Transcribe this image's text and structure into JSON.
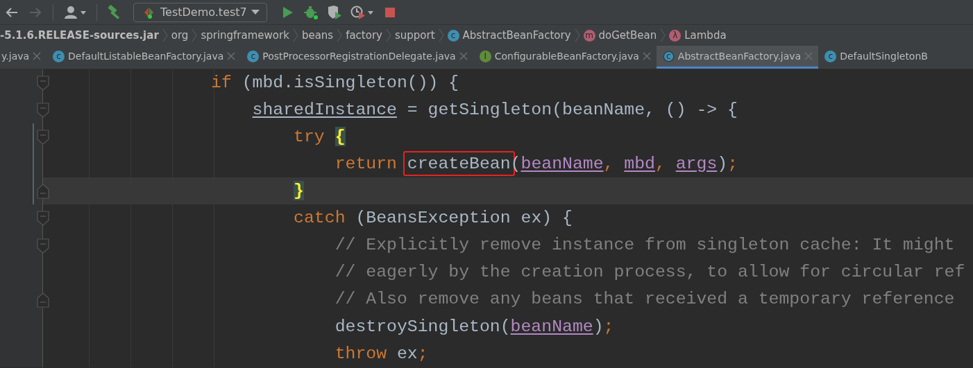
{
  "toolbar": {
    "buttons": [
      {
        "kind": "back",
        "disabled": false
      },
      {
        "kind": "forward",
        "disabled": true
      },
      {
        "kind": "separator"
      },
      {
        "kind": "user"
      },
      {
        "kind": "separator"
      },
      {
        "kind": "build"
      },
      {
        "kind": "run-config",
        "label": "TestDemo.test7"
      },
      {
        "kind": "run"
      },
      {
        "kind": "debug"
      },
      {
        "kind": "coverage"
      },
      {
        "kind": "profile"
      },
      {
        "kind": "stop"
      }
    ]
  },
  "breadcrumbs": [
    {
      "label": "-5.1.6.RELEASE-sources.jar",
      "bold": true
    },
    {
      "label": "org",
      "bold": false
    },
    {
      "label": "springframework",
      "bold": false
    },
    {
      "label": "beans",
      "bold": false
    },
    {
      "label": "factory",
      "bold": false
    },
    {
      "label": "support",
      "bold": false
    },
    {
      "label": "AbstractBeanFactory",
      "bold": false,
      "icon": {
        "kind": "class",
        "glyph": "c"
      }
    },
    {
      "label": "doGetBean",
      "bold": false,
      "icon": {
        "kind": "method",
        "glyph": "m"
      }
    },
    {
      "label": "Lambda",
      "bold": false,
      "icon": {
        "kind": "lambda",
        "glyph": "λ"
      }
    }
  ],
  "tabs": [
    {
      "label": "y.java",
      "selected": false,
      "closable": true
    },
    {
      "label": "DefaultListableBeanFactory.java",
      "selected": false,
      "closable": true,
      "icon": {
        "kind": "class",
        "glyph": "c"
      }
    },
    {
      "label": "PostProcessorRegistrationDelegate.java",
      "selected": false,
      "closable": true,
      "icon": {
        "kind": "class",
        "glyph": "c"
      }
    },
    {
      "label": "ConfigurableBeanFactory.java",
      "selected": false,
      "closable": true,
      "icon": {
        "kind": "interface",
        "glyph": "I"
      }
    },
    {
      "label": "AbstractBeanFactory.java",
      "selected": true,
      "closable": true,
      "icon": {
        "kind": "abstract",
        "glyph": "c"
      }
    },
    {
      "label": "DefaultSingletonB",
      "selected": false,
      "closable": false,
      "icon": {
        "kind": "class",
        "glyph": "c"
      }
    }
  ],
  "editor": {
    "lines": [
      {
        "fold": {
          "kind": "open"
        },
        "changed": false,
        "tokens": [
          {
            "kind": "kw",
            "text": "if"
          },
          {
            "kind": "plain",
            "text": " (mbd.isSingleton()) {"
          }
        ],
        "children": [
          {
            "fold": {
              "kind": "open"
            },
            "changed": false,
            "tokens": [
              {
                "kind": "underlined",
                "text": "sharedInstance"
              },
              {
                "kind": "plain",
                "text": " = getSingleton(beanName, () -> {"
              }
            ],
            "children": [
              {
                "fold": {
                  "kind": "open"
                },
                "changed": true,
                "tokens": [
                  {
                    "kind": "kw",
                    "text": "try "
                  },
                  {
                    "kind": "match",
                    "text": "{"
                  }
                ],
                "children": [
                  {
                    "changed": true,
                    "tokens": [
                      {
                        "kind": "kw",
                        "text": "return "
                      },
                      {
                        "kind": "plain",
                        "text": "createBean",
                        "boxed": true
                      },
                      {
                        "kind": "plain",
                        "text": "("
                      },
                      {
                        "kind": "captured",
                        "text": "beanName"
                      },
                      {
                        "kind": "kw",
                        "text": ", "
                      },
                      {
                        "kind": "captured",
                        "text": "mbd"
                      },
                      {
                        "kind": "kw",
                        "text": ", "
                      },
                      {
                        "kind": "captured",
                        "text": "args"
                      },
                      {
                        "kind": "plain",
                        "text": ")"
                      },
                      {
                        "kind": "kw",
                        "text": ";"
                      }
                    ]
                  }
                ]
              },
              {
                "fold": {
                  "kind": "close"
                },
                "changed": true,
                "current": true,
                "tokens": [
                  {
                    "kind": "match",
                    "text": "}"
                  }
                ]
              },
              {
                "fold": {
                  "kind": "open"
                },
                "changed": false,
                "tokens": [
                  {
                    "kind": "kw",
                    "text": "catch "
                  },
                  {
                    "kind": "plain",
                    "text": "(BeansException ex) {"
                  }
                ],
                "children": [
                  {
                    "fold": {
                      "kind": "open"
                    },
                    "changed": false,
                    "tokens": [
                      {
                        "kind": "comment",
                        "text": "// Explicitly remove instance from singleton cache: It might"
                      }
                    ]
                  },
                  {
                    "changed": false,
                    "tokens": [
                      {
                        "kind": "comment",
                        "text": "// eagerly by the creation process, to allow for circular ref"
                      }
                    ]
                  },
                  {
                    "fold": {
                      "kind": "close"
                    },
                    "changed": false,
                    "tokens": [
                      {
                        "kind": "comment",
                        "text": "// Also remove any beans that received a temporary reference"
                      }
                    ]
                  },
                  {
                    "changed": false,
                    "tokens": [
                      {
                        "kind": "plain",
                        "text": "destroySingleton("
                      },
                      {
                        "kind": "captured",
                        "text": "beanName"
                      },
                      {
                        "kind": "plain",
                        "text": ")"
                      },
                      {
                        "kind": "kw",
                        "text": ";"
                      }
                    ]
                  },
                  {
                    "changed": false,
                    "tokens": [
                      {
                        "kind": "kw",
                        "text": "throw "
                      },
                      {
                        "kind": "plain",
                        "text": "ex"
                      },
                      {
                        "kind": "kw",
                        "text": ";"
                      }
                    ]
                  }
                ]
              }
            ]
          }
        ]
      }
    ]
  }
}
